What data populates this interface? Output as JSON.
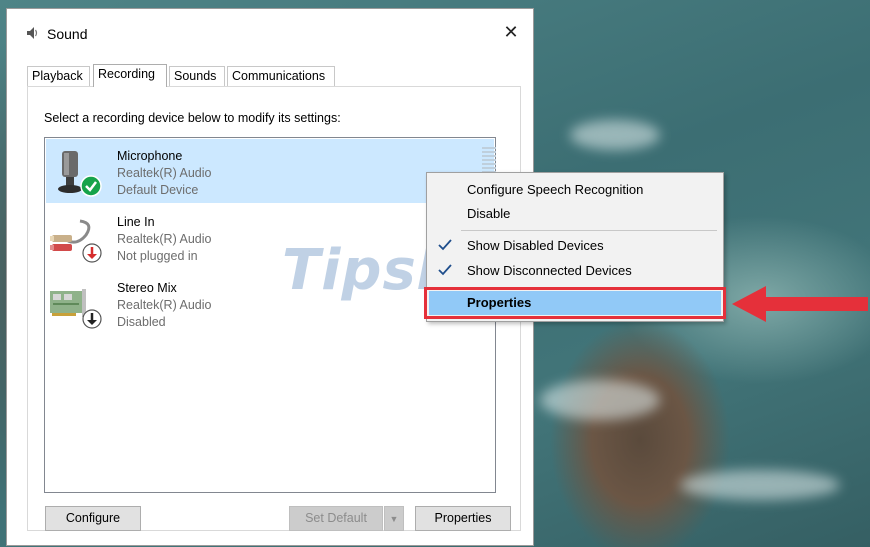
{
  "window": {
    "title": "Sound",
    "close_glyph": "✕"
  },
  "tabs": [
    {
      "label": "Playback",
      "active": false
    },
    {
      "label": "Recording",
      "active": true
    },
    {
      "label": "Sounds",
      "active": false
    },
    {
      "label": "Communications",
      "active": false
    }
  ],
  "instruction": "Select a recording device below to modify its settings:",
  "devices": [
    {
      "name": "Microphone",
      "driver": "Realtek(R) Audio",
      "status": "Default Device",
      "icon": "microphone-icon",
      "badge": "default-check-badge",
      "selected": true
    },
    {
      "name": "Line In",
      "driver": "Realtek(R) Audio",
      "status": "Not plugged in",
      "icon": "line-in-jack-icon",
      "badge": "not-plugged-badge",
      "selected": false
    },
    {
      "name": "Stereo Mix",
      "driver": "Realtek(R) Audio",
      "status": "Disabled",
      "icon": "sound-card-icon",
      "badge": "disabled-badge",
      "selected": false
    }
  ],
  "buttons": {
    "configure": "Configure",
    "set_default": "Set Default",
    "properties": "Properties"
  },
  "context_menu": {
    "items": [
      {
        "label": "Configure Speech Recognition",
        "checked": false
      },
      {
        "label": "Disable",
        "checked": false
      },
      {
        "label": "Show Disabled Devices",
        "checked": true
      },
      {
        "label": "Show Disconnected Devices",
        "checked": true
      },
      {
        "label": "Properties",
        "checked": false,
        "highlighted": true
      }
    ]
  },
  "watermark": {
    "text": "TipsMake",
    "suffix": ".com"
  },
  "colors": {
    "selection": "#cce8ff",
    "menu_highlight": "#91c9f7",
    "annotation_red": "#e5303a",
    "check_green": "#16a34a",
    "status_red": "#d62c2c"
  }
}
